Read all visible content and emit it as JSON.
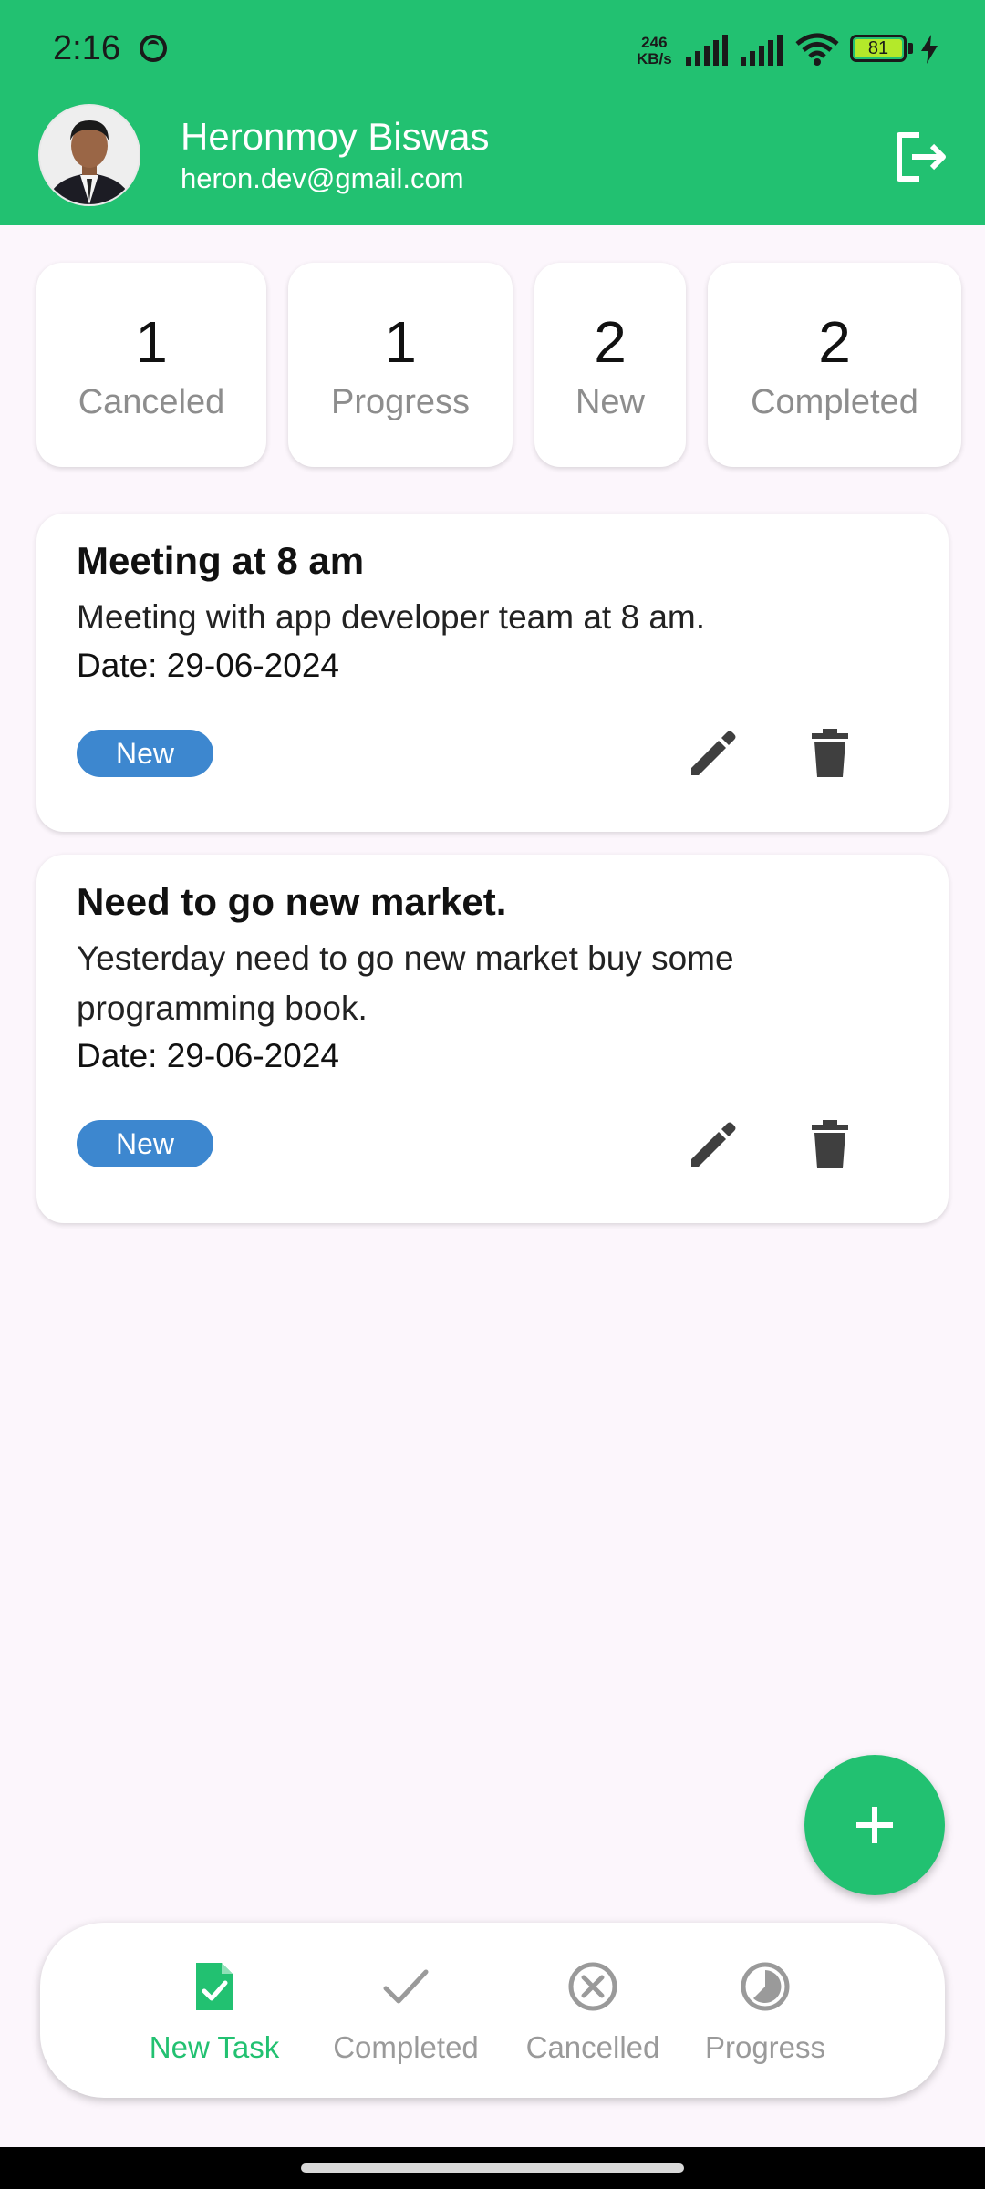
{
  "status_bar": {
    "time": "2:16",
    "net_speed_value": "246",
    "net_speed_unit": "KB/s",
    "battery": "81"
  },
  "profile": {
    "name": "Heronmoy Biswas",
    "email": "heron.dev@gmail.com"
  },
  "summary": [
    {
      "count": "1",
      "label": "Canceled"
    },
    {
      "count": "1",
      "label": "Progress"
    },
    {
      "count": "2",
      "label": "New"
    },
    {
      "count": "2",
      "label": "Completed"
    }
  ],
  "tasks": [
    {
      "title": "Meeting at 8 am",
      "description": "Meeting with app developer team at 8 am.",
      "date": "Date: 29-06-2024",
      "status": "New"
    },
    {
      "title": "Need to go new market.",
      "description": "Yesterday need to go new market buy some programming book.",
      "date": "Date: 29-06-2024",
      "status": "New"
    }
  ],
  "bottom_nav": [
    {
      "label": "New Task",
      "icon": "task-check-icon",
      "active": true
    },
    {
      "label": "Completed",
      "icon": "check-icon",
      "active": false
    },
    {
      "label": "Cancelled",
      "icon": "cancel-circle-icon",
      "active": false
    },
    {
      "label": "Progress",
      "icon": "progress-icon",
      "active": false
    }
  ],
  "colors": {
    "primary": "#22C171",
    "badge": "#3D87CF",
    "background": "#FCF6FC"
  }
}
